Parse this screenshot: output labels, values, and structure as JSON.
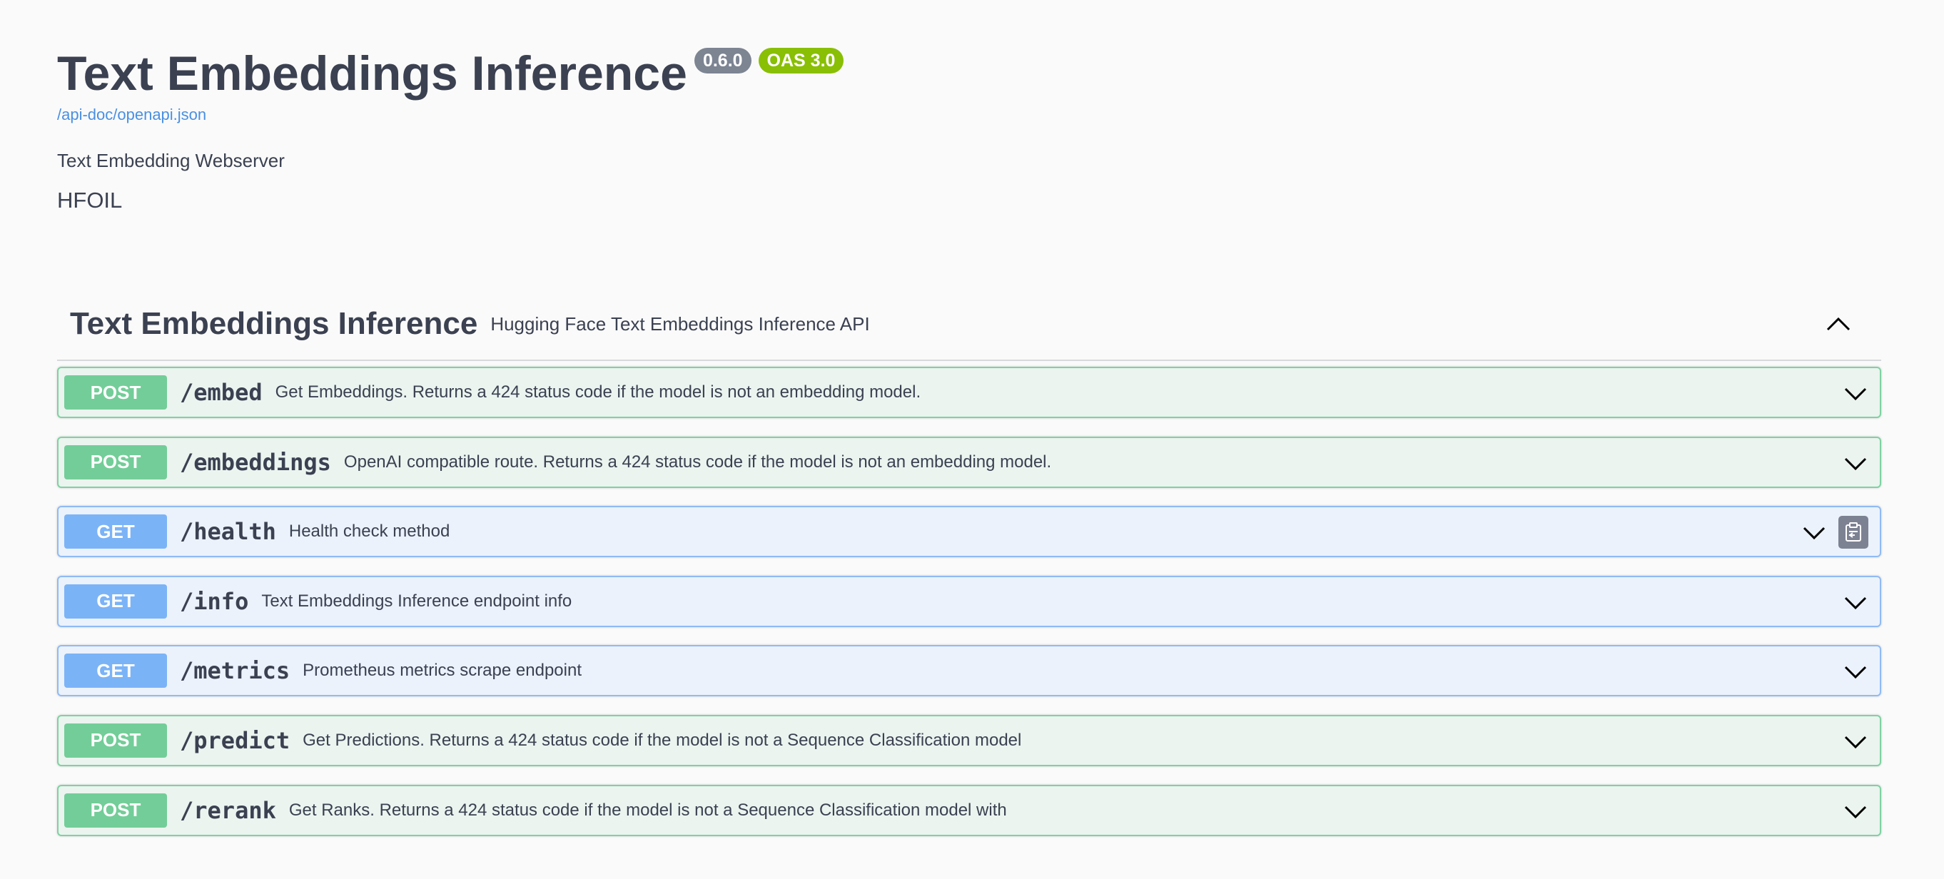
{
  "info": {
    "title": "Text Embeddings Inference",
    "version": "0.6.0",
    "oas": "OAS 3.0",
    "spec_link": "/api-doc/openapi.json",
    "description": "Text Embedding Webserver",
    "license": "HFOIL"
  },
  "tag": {
    "name": "Text Embeddings Inference",
    "description": "Hugging Face Text Embeddings Inference API",
    "toggle_icon": "chevron-up-icon"
  },
  "operations": [
    {
      "method": "POST",
      "path": "/embed",
      "summary": "Get Embeddings. Returns a 424 status code if the model is not an embedding model."
    },
    {
      "method": "POST",
      "path": "/embeddings",
      "summary": "OpenAI compatible route. Returns a 424 status code if the model is not an embedding model."
    },
    {
      "method": "GET",
      "path": "/health",
      "summary": "Health check method",
      "copy_icon": "clipboard-icon"
    },
    {
      "method": "GET",
      "path": "/info",
      "summary": "Text Embeddings Inference endpoint info"
    },
    {
      "method": "GET",
      "path": "/metrics",
      "summary": "Prometheus metrics scrape endpoint"
    },
    {
      "method": "POST",
      "path": "/predict",
      "summary": "Get Predictions. Returns a 424 status code if the model is not a Sequence Classification model"
    },
    {
      "method": "POST",
      "path": "/rerank",
      "summary": "Get Ranks. Returns a 424 status code if the model is not a Sequence Classification model with"
    }
  ],
  "colors": {
    "post_bg": "#ebf4ef",
    "post_border": "#7ed2a1",
    "post_method": "#73cd98",
    "get_bg": "#ebf2fb",
    "get_border": "#8fbbf5",
    "get_method": "#7bb3f7",
    "version_badge": "#7d8492",
    "oas_badge": "#89bf04",
    "link": "#4990e2"
  }
}
